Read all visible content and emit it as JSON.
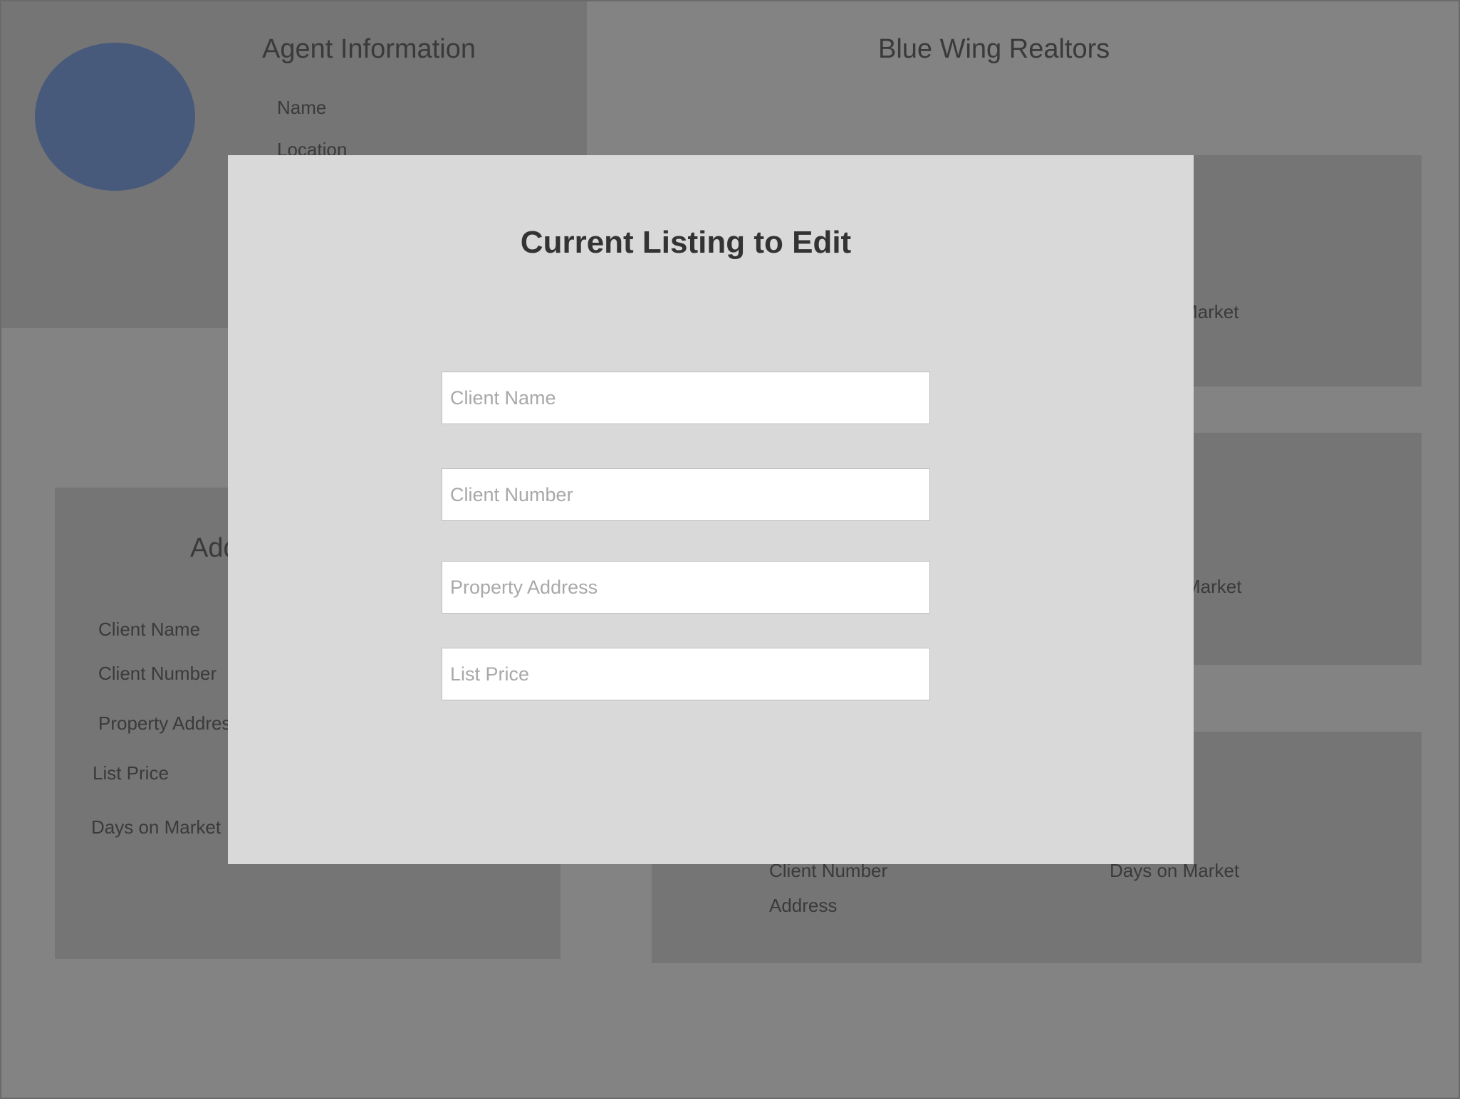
{
  "agent_panel": {
    "title": "Agent Information",
    "name_label": "Name",
    "location_label": "Location"
  },
  "header": {
    "title": "Blue Wing Realtors"
  },
  "add_panel": {
    "title_visible": "Add",
    "client_name_label": "Client Name",
    "client_number_label": "Client Number",
    "property_address_label": "Property Address",
    "list_price_label": "List Price",
    "days_on_market_label": "Days on Market"
  },
  "listing_cards": [
    {
      "days_on_market_visible": "Market"
    },
    {
      "days_on_market_visible": "Market"
    },
    {
      "client_number_label": "Client Number",
      "address_label": "Address",
      "days_on_market_label": "Days on Market"
    }
  ],
  "modal": {
    "title": "Current Listing to Edit",
    "fields": {
      "client_name": {
        "placeholder": "Client Name",
        "value": ""
      },
      "client_number": {
        "placeholder": "Client Number",
        "value": ""
      },
      "property_address": {
        "placeholder": "Property Address",
        "value": ""
      },
      "list_price": {
        "placeholder": "List Price",
        "value": ""
      }
    }
  },
  "colors": {
    "backdrop": "#838383",
    "panel": "#757575",
    "avatar": "#485a7b",
    "modal": "#d9d9d9",
    "input_bg": "#ffffff"
  }
}
